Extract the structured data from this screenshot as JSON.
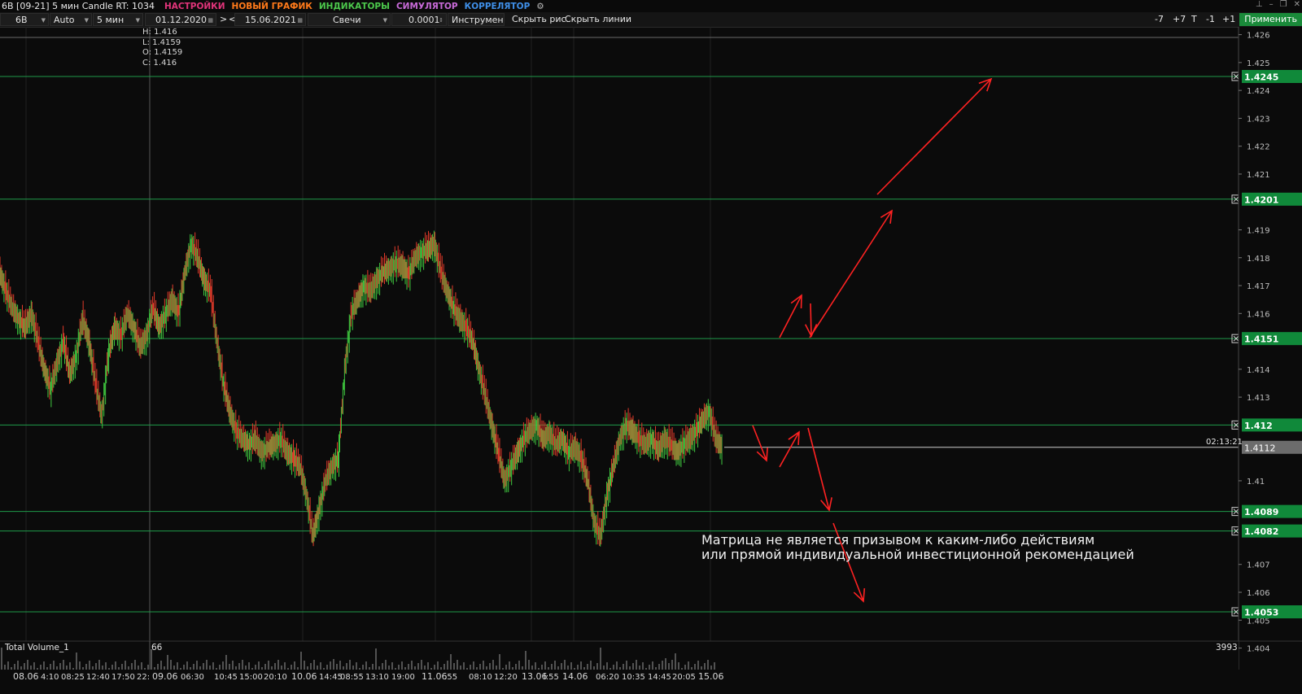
{
  "titlebar": {
    "title": "6B [09-21] 5 мин Candle RT: 1034",
    "menus": [
      {
        "label": "НАСТРОЙКИ",
        "color": "#e0347a"
      },
      {
        "label": "НОВЫЙ ГРАФИК",
        "color": "#ff7a1a"
      },
      {
        "label": "ИНДИКАТОРЫ",
        "color": "#4cc84c"
      },
      {
        "label": "СИМУЛЯТОР",
        "color": "#c86ad8"
      },
      {
        "label": "КОРРЕЛЯТОР",
        "color": "#3f8fe8"
      }
    ]
  },
  "toolbar": {
    "symbol": "6B",
    "scale": "Auto",
    "timeframe": "5 мин",
    "date_from": "01.12.2020",
    "nav_next": ">",
    "nav_prev": "<",
    "date_to": "15.06.2021",
    "chart_type": "Свечи",
    "tick": "0.0001",
    "tools": "Инструменты",
    "hide_drawings": "Скрыть рис.",
    "hide_lines": "Скрыть линии",
    "btn_minus7": "-7",
    "btn_plus7": "+7",
    "btn_t": "T",
    "btn_minus1": "-1",
    "btn_plus1": "+1",
    "apply": "Применить"
  },
  "ohlc": {
    "h": "H: 1.416",
    "l": "L: 1.4159",
    "o": "O: 1.4159",
    "c": "C: 1.416"
  },
  "disclaimer": {
    "line1": "Матрица не является призывом к каким-либо действиям",
    "line2": "или прямой индивидуальной инвестиционной рекомендацией"
  },
  "volume": {
    "label": "Total Volume_1",
    "current": "66",
    "max": "3993"
  },
  "time_remaining": "02:13:21",
  "chart_data": {
    "type": "line",
    "title": "6B [09-21] 5 мин Candle",
    "ylim": [
      1.4035,
      1.4265
    ],
    "yticks": [
      "1.426",
      "1.425",
      "1.424",
      "1.423",
      "1.422",
      "1.421",
      "1.419",
      "1.418",
      "1.417",
      "1.416",
      "1.414",
      "1.413",
      "1.41",
      "1.407",
      "1.406",
      "1.405",
      "1.404"
    ],
    "ytick_values": [
      1.426,
      1.425,
      1.424,
      1.423,
      1.422,
      1.421,
      1.419,
      1.418,
      1.417,
      1.416,
      1.414,
      1.413,
      1.41,
      1.407,
      1.406,
      1.405,
      1.404
    ],
    "xticks": [
      "08.06",
      "4:10",
      "08:25",
      "12:40",
      "17:50",
      "22:",
      "09.06",
      "06:30",
      "10:45",
      "15:00",
      "20:10",
      "10.06",
      "14:45",
      "08:55",
      "13:10",
      "19:00",
      "11.06",
      ":55",
      "08:10",
      "12:20",
      "13.06",
      "l:55",
      "14.06",
      "06:20",
      "10:35",
      "14:45",
      "20:05",
      "15.06"
    ],
    "levels": [
      {
        "value": 1.4245,
        "label": "1.4245"
      },
      {
        "value": 1.4201,
        "label": "1.4201"
      },
      {
        "value": 1.4151,
        "label": "1.4151"
      },
      {
        "value": 1.412,
        "label": "1.412"
      },
      {
        "value": 1.4089,
        "label": "1.4089"
      },
      {
        "value": 1.4082,
        "label": "1.4082"
      },
      {
        "value": 1.4053,
        "label": "1.4053"
      }
    ],
    "current_price": {
      "value": 1.4112,
      "label": "1.4112"
    },
    "series": [
      {
        "values": [
          1.4175,
          1.4168,
          1.4162,
          1.4158,
          1.4155,
          1.416,
          1.415,
          1.414,
          1.4133,
          1.4142,
          1.415,
          1.4138,
          1.4145,
          1.4158,
          1.415,
          1.4135,
          1.4123,
          1.4145,
          1.4155,
          1.4152,
          1.416,
          1.4155,
          1.4148,
          1.4152,
          1.4162,
          1.4155,
          1.416,
          1.4165,
          1.416,
          1.4175,
          1.4185,
          1.418,
          1.4172,
          1.4168,
          1.415,
          1.4135,
          1.4125,
          1.4118,
          1.4115,
          1.4113,
          1.4115,
          1.411,
          1.4112,
          1.4113,
          1.4115,
          1.411,
          1.4108,
          1.4105,
          1.4095,
          1.408,
          1.409,
          1.41,
          1.4105,
          1.4108,
          1.414,
          1.416,
          1.4165,
          1.417,
          1.4168,
          1.4172,
          1.4175,
          1.4176,
          1.4178,
          1.4177,
          1.4174,
          1.418,
          1.4182,
          1.4183,
          1.4185,
          1.4175,
          1.4168,
          1.4162,
          1.4158,
          1.4155,
          1.415,
          1.414,
          1.413,
          1.412,
          1.411,
          1.41,
          1.4105,
          1.411,
          1.4115,
          1.4118,
          1.412,
          1.4115,
          1.4117,
          1.4113,
          1.4115,
          1.411,
          1.4112,
          1.4108,
          1.41,
          1.4085,
          1.408,
          1.4095,
          1.4105,
          1.4115,
          1.412,
          1.4118,
          1.4115,
          1.4113,
          1.4115,
          1.4111,
          1.4115,
          1.4113,
          1.411,
          1.4113,
          1.4115,
          1.4118,
          1.4122,
          1.4125,
          1.4115,
          1.4112
        ]
      }
    ]
  }
}
